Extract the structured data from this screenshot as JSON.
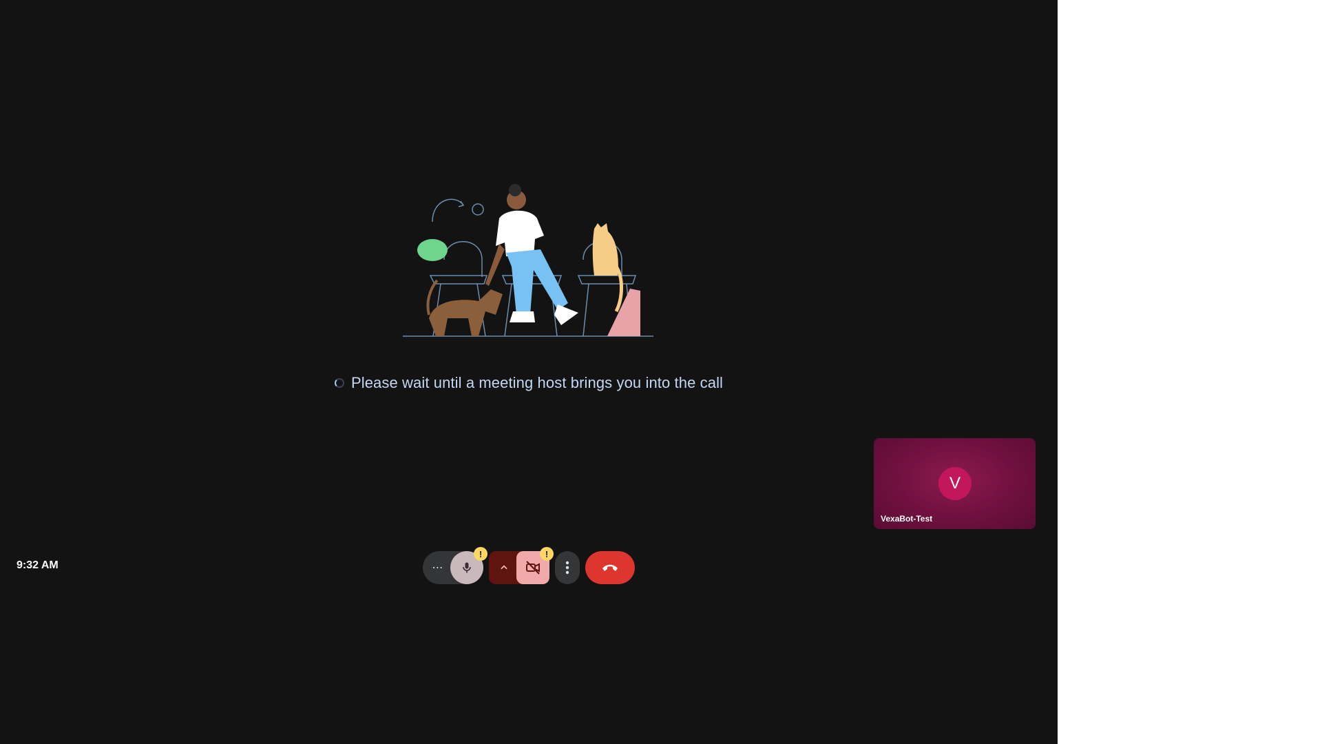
{
  "lobby": {
    "status_text": "Please wait until a meeting host brings you into the call"
  },
  "self_view": {
    "avatar_initial": "V",
    "name": "VexaBot-Test"
  },
  "clock": {
    "time": "9:32 AM"
  },
  "controls": {
    "audio_options_label": "⋯",
    "mic_warning": "!",
    "camera_warning": "!"
  },
  "colors": {
    "background": "#131314",
    "leave_red": "#dc362e",
    "avatar_pink": "#c2185b",
    "warning_yellow": "#fdd663"
  },
  "icons": {
    "status": "loading-spinner-icon",
    "mic": "microphone-icon",
    "camera": "camera-off-icon",
    "chevron": "chevron-up-icon",
    "more": "more-vertical-icon",
    "leave": "call-end-icon"
  }
}
